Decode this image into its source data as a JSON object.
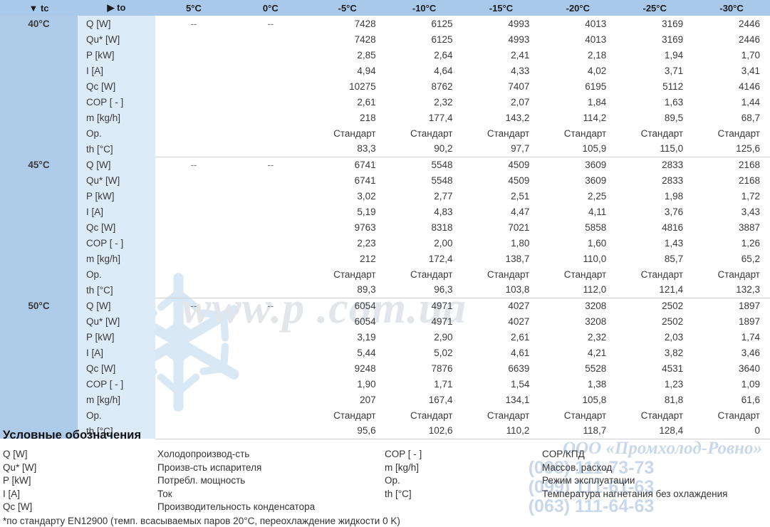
{
  "table": {
    "corner_tc": "▼ tc",
    "corner_to": "▶ to",
    "columns": [
      "5°C",
      "0°C",
      "-5°C",
      "-10°C",
      "-15°C",
      "-20°C",
      "-25°C",
      "-30°C"
    ],
    "row_labels": [
      "Q [W]",
      "Qu* [W]",
      "P [kW]",
      "I [A]",
      "Qc [W]",
      "COP [ - ]",
      "m [kg/h]",
      "Op.",
      "th [°C]"
    ],
    "blocks": [
      {
        "tc": "40°C",
        "rows": [
          [
            "--",
            "--",
            "7428",
            "6125",
            "4993",
            "4013",
            "3169",
            "2446"
          ],
          [
            "",
            "",
            "7428",
            "6125",
            "4993",
            "4013",
            "3169",
            "2446"
          ],
          [
            "",
            "",
            "2,85",
            "2,64",
            "2,41",
            "2,18",
            "1,94",
            "1,70"
          ],
          [
            "",
            "",
            "4,94",
            "4,64",
            "4,33",
            "4,02",
            "3,71",
            "3,41"
          ],
          [
            "",
            "",
            "10275",
            "8762",
            "7407",
            "6195",
            "5112",
            "4146"
          ],
          [
            "",
            "",
            "2,61",
            "2,32",
            "2,07",
            "1,84",
            "1,63",
            "1,44"
          ],
          [
            "",
            "",
            "218",
            "177,4",
            "143,2",
            "114,2",
            "89,5",
            "68,7"
          ],
          [
            "",
            "",
            "Стандарт",
            "Стандарт",
            "Стандарт",
            "Стандарт",
            "Стандарт",
            "Стандарт"
          ],
          [
            "",
            "",
            "83,3",
            "90,2",
            "97,7",
            "105,9",
            "115,0",
            "125,6"
          ]
        ]
      },
      {
        "tc": "45°C",
        "rows": [
          [
            "--",
            "--",
            "6741",
            "5548",
            "4509",
            "3609",
            "2833",
            "2168"
          ],
          [
            "",
            "",
            "6741",
            "5548",
            "4509",
            "3609",
            "2833",
            "2168"
          ],
          [
            "",
            "",
            "3,02",
            "2,77",
            "2,51",
            "2,25",
            "1,98",
            "1,72"
          ],
          [
            "",
            "",
            "5,19",
            "4,83",
            "4,47",
            "4,11",
            "3,76",
            "3,43"
          ],
          [
            "",
            "",
            "9763",
            "8318",
            "7021",
            "5858",
            "4816",
            "3887"
          ],
          [
            "",
            "",
            "2,23",
            "2,00",
            "1,80",
            "1,60",
            "1,43",
            "1,26"
          ],
          [
            "",
            "",
            "212",
            "172,4",
            "138,7",
            "110,0",
            "85,7",
            "65,2"
          ],
          [
            "",
            "",
            "Стандарт",
            "Стандарт",
            "Стандарт",
            "Стандарт",
            "Стандарт",
            "Стандарт"
          ],
          [
            "",
            "",
            "89,3",
            "96,3",
            "103,8",
            "112,0",
            "121,4",
            "132,3"
          ]
        ]
      },
      {
        "tc": "50°C",
        "rows": [
          [
            "--",
            "--",
            "6054",
            "4971",
            "4027",
            "3208",
            "2502",
            "1897"
          ],
          [
            "",
            "",
            "6054",
            "4971",
            "4027",
            "3208",
            "2502",
            "1897"
          ],
          [
            "",
            "",
            "3,19",
            "2,90",
            "2,61",
            "2,32",
            "2,03",
            "1,74"
          ],
          [
            "",
            "",
            "5,44",
            "5,02",
            "4,61",
            "4,21",
            "3,82",
            "3,46"
          ],
          [
            "",
            "",
            "9248",
            "7876",
            "6639",
            "5528",
            "4531",
            "3640"
          ],
          [
            "",
            "",
            "1,90",
            "1,71",
            "1,54",
            "1,38",
            "1,23",
            "1,09"
          ],
          [
            "",
            "",
            "207",
            "167,4",
            "134,1",
            "105,8",
            "81,8",
            "61,6"
          ],
          [
            "",
            "",
            "Стандарт",
            "Стандарт",
            "Стандарт",
            "Стандарт",
            "Стандарт",
            "Стандарт"
          ],
          [
            "",
            "",
            "95,6",
            "102,6",
            "110,2",
            "118,7",
            "128,4",
            "0"
          ]
        ]
      }
    ]
  },
  "legend": {
    "title": "Условные обозначения",
    "entries_left": [
      {
        "symbol": "Q [W]",
        "desc": "Холодопроизвод-сть"
      },
      {
        "symbol": "Qu* [W]",
        "desc": "Произв-сть испарителя"
      },
      {
        "symbol": "P [kW]",
        "desc": "Потребл. мощность"
      },
      {
        "symbol": "I [A]",
        "desc": "Ток"
      },
      {
        "symbol": "Qc [W]",
        "desc": "Производительность конденсатора"
      }
    ],
    "entries_right": [
      {
        "symbol": "COP [ - ]",
        "desc": "COP/КПД"
      },
      {
        "symbol": "m [kg/h]",
        "desc": "Массов. расход"
      },
      {
        "symbol": "Op.",
        "desc": "Режим эксплуатации"
      },
      {
        "symbol": "th [°C]",
        "desc": "Температура нагнетания без охлаждения"
      }
    ],
    "footnote": "*по стандарту EN12900 (темп. всасываемых паров 20°C, переохлаждение жидкости 0 K)"
  },
  "watermark": {
    "site": "www.p          .com.ua",
    "company": "ООО «Промхолод-Ровно»",
    "phones": "(098) 111-73-73\n(099) 111-61-63\n(063) 111-64-63"
  },
  "colors": {
    "header_blue": "#a8c9ea",
    "tc_blue": "#aecbea",
    "label_blue": "#ddebf8",
    "text": "#3a3a3a",
    "watermark": "#c7d8ea"
  }
}
